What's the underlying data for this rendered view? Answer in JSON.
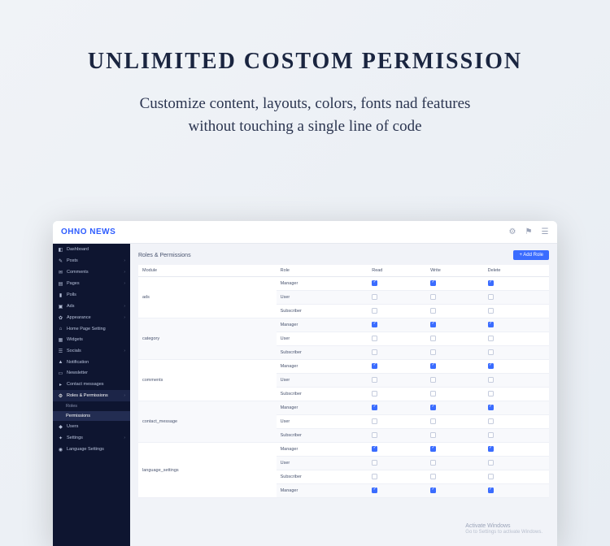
{
  "hero": {
    "title": "UNLIMITED COSTOM PERMISSION",
    "subtitle_l1": "Customize content, layouts, colors, fonts nad features",
    "subtitle_l2": "without touching a single line of code"
  },
  "topbar": {
    "brand": "OHNO NEWS"
  },
  "sidebar": {
    "items": [
      {
        "icon": "◧",
        "label": "Dashboard"
      },
      {
        "icon": "✎",
        "label": "Posts",
        "chev": true
      },
      {
        "icon": "✉",
        "label": "Comments",
        "chev": true
      },
      {
        "icon": "▤",
        "label": "Pages",
        "chev": true
      },
      {
        "icon": "▮",
        "label": "Polls"
      },
      {
        "icon": "▣",
        "label": "Ads",
        "chev": true
      },
      {
        "icon": "✿",
        "label": "Appearance",
        "chev": true
      },
      {
        "icon": "⌂",
        "label": "Home Page Setting"
      },
      {
        "icon": "▦",
        "label": "Widgets"
      },
      {
        "icon": "☰",
        "label": "Socials",
        "chev": true
      },
      {
        "icon": "▲",
        "label": "Notification"
      },
      {
        "icon": "▭",
        "label": "Newsletter"
      },
      {
        "icon": "▸",
        "label": "Contact messages"
      },
      {
        "icon": "⚙",
        "label": "Roles & Permissions",
        "chev": true,
        "active": true
      },
      {
        "sub": true,
        "label": "Roles"
      },
      {
        "sub": true,
        "label": "Permissions",
        "active": true
      },
      {
        "icon": "◆",
        "label": "Users"
      },
      {
        "icon": "✦",
        "label": "Settings",
        "chev": true
      },
      {
        "icon": "◉",
        "label": "Language Settings"
      }
    ]
  },
  "main": {
    "title": "Roles & Permissions",
    "add_button": "+  Add Role",
    "columns": [
      "Module",
      "Role",
      "Read",
      "Write",
      "Delete"
    ],
    "groups": [
      {
        "module": "ads",
        "rows": [
          {
            "role": "Manager",
            "r": true,
            "w": true,
            "d": true
          },
          {
            "role": "User",
            "r": false,
            "w": false,
            "d": false
          },
          {
            "role": "Subscriber",
            "r": false,
            "w": false,
            "d": false
          }
        ]
      },
      {
        "module": "category",
        "rows": [
          {
            "role": "Manager",
            "r": true,
            "w": true,
            "d": true
          },
          {
            "role": "User",
            "r": false,
            "w": false,
            "d": false
          },
          {
            "role": "Subscriber",
            "r": false,
            "w": false,
            "d": false
          }
        ]
      },
      {
        "module": "comments",
        "rows": [
          {
            "role": "Manager",
            "r": true,
            "w": true,
            "d": true
          },
          {
            "role": "User",
            "r": false,
            "w": false,
            "d": false
          },
          {
            "role": "Subscriber",
            "r": false,
            "w": false,
            "d": false
          }
        ]
      },
      {
        "module": "contact_message",
        "rows": [
          {
            "role": "Manager",
            "r": true,
            "w": true,
            "d": true
          },
          {
            "role": "User",
            "r": false,
            "w": false,
            "d": false
          },
          {
            "role": "Subscriber",
            "r": false,
            "w": false,
            "d": false
          }
        ]
      },
      {
        "module": "language_settings",
        "rows": [
          {
            "role": "Manager",
            "r": true,
            "w": true,
            "d": true
          },
          {
            "role": "User",
            "r": false,
            "w": false,
            "d": false
          },
          {
            "role": "Subscriber",
            "r": false,
            "w": false,
            "d": false
          },
          {
            "role": "Manager",
            "r": true,
            "w": true,
            "d": true
          }
        ]
      }
    ]
  },
  "watermark": {
    "h": "Activate Windows",
    "t": "Go to Settings to activate Windows."
  }
}
